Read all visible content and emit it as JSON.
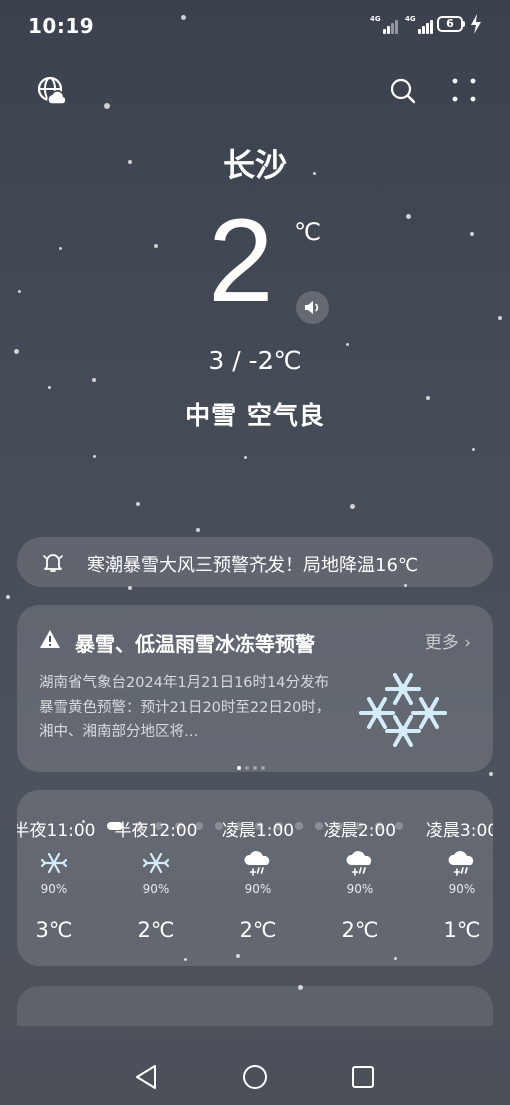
{
  "status_bar": {
    "time": "10:19",
    "signal1_label": "4G",
    "signal2_label": "4G",
    "battery": "6"
  },
  "top_bar": {
    "left_icon": "globe-weather-icon",
    "search_icon": "search-icon",
    "menu_icon": "menu-dots-icon"
  },
  "weather": {
    "city": "长沙",
    "temp": "2",
    "unit": "℃",
    "range": "3 / -2℃",
    "condition": "中雪  空气良"
  },
  "alert": {
    "text": "寒潮暴雪大风三预警齐发！局地降温16℃"
  },
  "warning": {
    "title": "暴雪、低温雨雪冰冻等预警",
    "more": "更多 ›",
    "body": "湖南省气象台2024年1月21日16时14分发布暴雪黄色预警：预计21日20时至22日20时，湘中、湘南部分地区将…",
    "page_dot_count": 4,
    "active_dot": 0
  },
  "hourly": [
    {
      "time": "半夜11:00",
      "icon": "snowflake-icon",
      "precip": "90%",
      "temp": "3℃"
    },
    {
      "time": "半夜12:00",
      "icon": "snowflake-icon",
      "precip": "90%",
      "temp": "2℃"
    },
    {
      "time": "凌晨1:00",
      "icon": "cloud-snow-icon",
      "precip": "90%",
      "temp": "2℃"
    },
    {
      "time": "凌晨2:00",
      "icon": "cloud-snow-icon",
      "precip": "90%",
      "temp": "2℃"
    },
    {
      "time": "凌晨3:00",
      "icon": "cloud-snow-icon",
      "precip": "90%",
      "temp": "1℃"
    }
  ],
  "pager": {
    "count": 15,
    "active": 0
  },
  "nav": {
    "back_icon": "back-triangle-icon",
    "home_icon": "home-circle-icon",
    "recents_icon": "recents-square-icon"
  },
  "colors": {
    "background_top": "#3b414d",
    "background_bottom": "#4b5059",
    "card": "rgba(255,255,255,0.13)",
    "snowflake_blue": "#cfe8f7"
  }
}
